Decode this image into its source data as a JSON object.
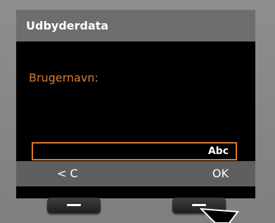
{
  "title": "Udbyderdata",
  "field": {
    "label": "Brugernavn:",
    "value": "",
    "input_mode": "Abc"
  },
  "softkeys": {
    "left": "< C",
    "right": "OK"
  },
  "icons": [
    "softkey-left-icon",
    "softkey-right-icon",
    "pointer-arrow-icon"
  ],
  "colors": {
    "accent": "#e07a2a",
    "screen_bg": "#000000",
    "title_bg": "#6d6d6d",
    "softkey_bg": "#5f5f5f"
  }
}
